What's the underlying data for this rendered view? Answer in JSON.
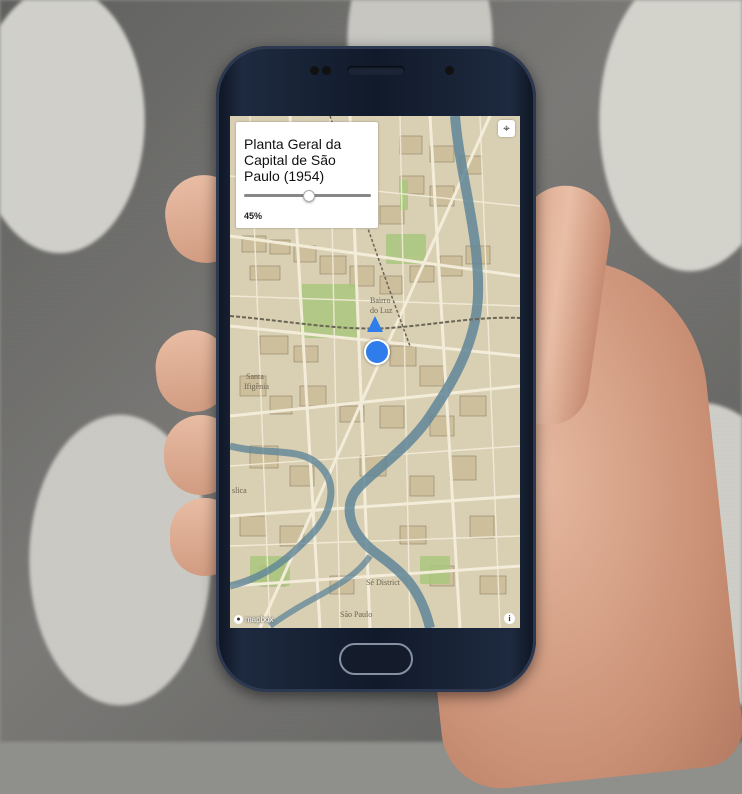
{
  "overlay": {
    "title": "Planta Geral da Capital de São Paulo (1954)",
    "opacity_value": 0.45,
    "opacity_label": "45%"
  },
  "map": {
    "labels": [
      {
        "text": "Bairro",
        "id": "bairro"
      },
      {
        "text": "do Luz",
        "id": "luz"
      },
      {
        "text": "Santa",
        "id": "santa"
      },
      {
        "text": "Ifigênia",
        "id": "ifigenia"
      },
      {
        "text": "Sé District",
        "id": "se-district"
      },
      {
        "text": "São Paulo",
        "id": "sao-paulo"
      },
      {
        "text": "slica",
        "id": "slica"
      }
    ],
    "attribution": "mapbox",
    "icons": {
      "geolocate": "geolocate-icon",
      "info": "info-icon",
      "mapbox_logo": "mapbox-logo-icon"
    }
  },
  "colors": {
    "location": "#2e7dea",
    "river": "#5f8698",
    "park": "#a9c77f",
    "paper": "#d8cfb4"
  }
}
